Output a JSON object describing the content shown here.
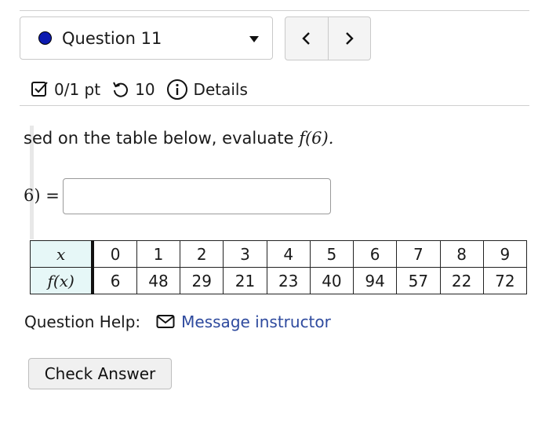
{
  "question_select": {
    "label": "Question 11",
    "status_color": "#0d1bb0"
  },
  "nav": {
    "prev_icon": "chevron-left-icon",
    "next_icon": "chevron-right-icon"
  },
  "meta": {
    "score": "0/1 pt",
    "retries": "10",
    "details_label": "Details"
  },
  "question": {
    "prompt_prefix": "sed on the table below, evaluate ",
    "prompt_math": "f(6).",
    "answer_label_math": "6)",
    "answer_label_equals": " =",
    "answer_value": ""
  },
  "table": {
    "row_labels": [
      "x",
      "f(x)"
    ],
    "x": [
      "0",
      "1",
      "2",
      "3",
      "4",
      "5",
      "6",
      "7",
      "8",
      "9"
    ],
    "fx": [
      "6",
      "48",
      "29",
      "21",
      "23",
      "40",
      "94",
      "57",
      "22",
      "72"
    ]
  },
  "help": {
    "label": "Question Help:",
    "link": "Message instructor"
  },
  "check_button": {
    "label": "Check Answer"
  }
}
